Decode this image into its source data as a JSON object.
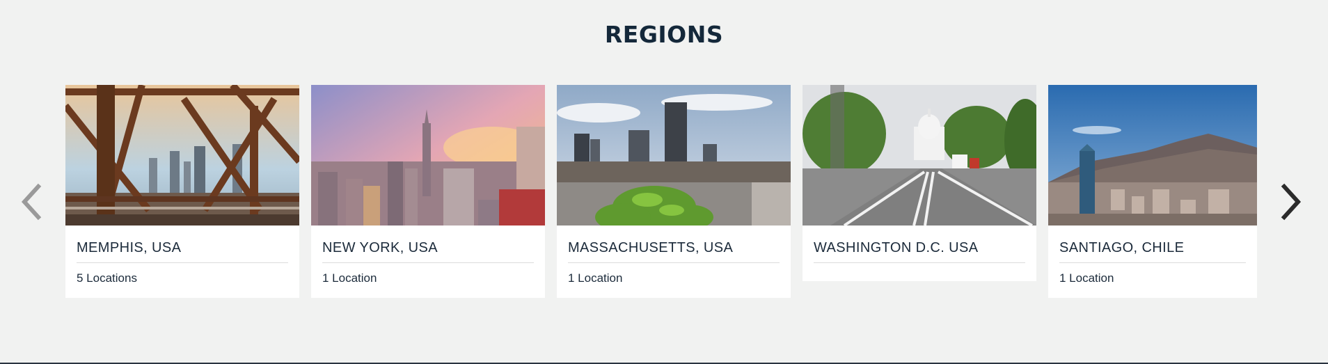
{
  "section": {
    "title": "REGIONS"
  },
  "carousel": {
    "prev_icon": "chevron-left-icon",
    "next_icon": "chevron-right-icon",
    "regions": [
      {
        "name": "MEMPHIS, USA",
        "count": "5 Locations",
        "image": "bridge-skyline-photo"
      },
      {
        "name": "NEW YORK, USA",
        "count": "1 Location",
        "image": "manhattan-sunset-photo"
      },
      {
        "name": "MASSACHUSETTS, USA",
        "count": "1 Location",
        "image": "boston-skyline-photo"
      },
      {
        "name": "WASHINGTON D.C. USA",
        "count": "",
        "image": "capitol-avenue-photo"
      },
      {
        "name": "SANTIAGO, CHILE",
        "count": "1 Location",
        "image": "santiago-mountains-photo"
      }
    ]
  },
  "colors": {
    "background": "#f1f2f1",
    "title": "#14283a",
    "card": "#ffffff",
    "arrow_left": "#9a9a9a",
    "arrow_right": "#2b2b2b"
  }
}
